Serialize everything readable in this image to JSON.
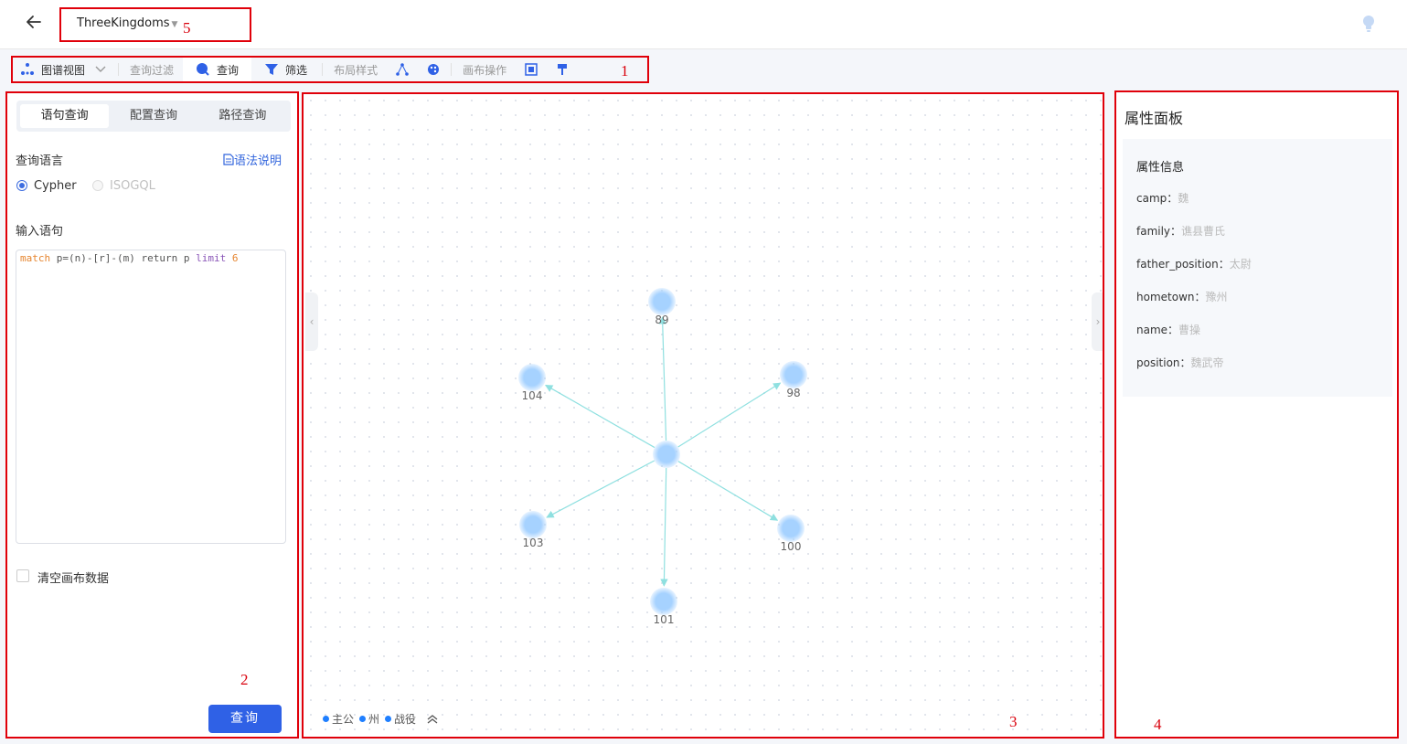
{
  "header": {
    "graph_name": "ThreeKingdoms",
    "back_icon": "arrow-left-icon",
    "help_icon": "lightbulb-icon"
  },
  "toolbar": {
    "view_label": "图谱视图",
    "group_query_filter": "查询过滤",
    "query_label": "查询",
    "filter_label": "筛选",
    "group_layout": "布局样式",
    "group_canvas": "画布操作"
  },
  "left_panel": {
    "tabs": [
      "语句查询",
      "配置查询",
      "路径查询"
    ],
    "language_label": "查询语言",
    "syntax_link": "语法说明",
    "languages": [
      {
        "label": "Cypher",
        "selected": true
      },
      {
        "label": "ISOGQL",
        "selected": false
      }
    ],
    "input_label": "输入语句",
    "query": {
      "kw_match": "match",
      "pattern": " p=(n)-[r]-(m) return p ",
      "kw_limit": "limit",
      "limit_value": "6"
    },
    "clear_label": "清空画布数据",
    "submit_label": "查询"
  },
  "graph": {
    "center_node": "",
    "nodes": [
      "89",
      "98",
      "100",
      "101",
      "103",
      "104"
    ],
    "node_color": "#a6d2ff",
    "edge_color": "#8fe0e0",
    "legend": [
      "主公",
      "州",
      "战役"
    ]
  },
  "properties": {
    "title": "属性面板",
    "subtitle": "属性信息",
    "rows": [
      {
        "key": "camp：",
        "value": "魏"
      },
      {
        "key": "family：",
        "value": "谯县曹氏"
      },
      {
        "key": "father_position：",
        "value": "太尉"
      },
      {
        "key": "hometown：",
        "value": "豫州"
      },
      {
        "key": "name：",
        "value": "曹操"
      },
      {
        "key": "position：",
        "value": "魏武帝"
      }
    ]
  },
  "annotations": [
    "1",
    "2",
    "3",
    "4",
    "5"
  ]
}
